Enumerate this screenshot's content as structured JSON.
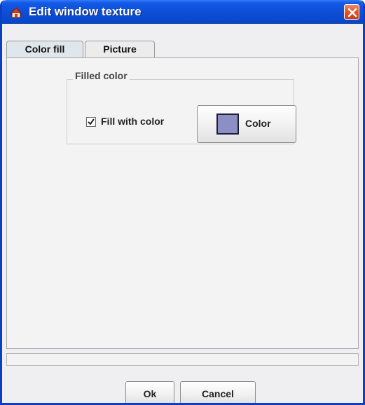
{
  "window": {
    "title": "Edit window texture",
    "icon": "app-icon",
    "close_icon": "close-icon"
  },
  "tabs": [
    {
      "label": "Color fill",
      "selected": true
    },
    {
      "label": "Picture",
      "selected": false
    }
  ],
  "filled_color_group": {
    "title": "Filled color",
    "fill_checkbox": {
      "label": "Fill with color",
      "checked": true
    },
    "color_button": {
      "label": "Color",
      "swatch_color": "#8b8fc4"
    }
  },
  "footer": {
    "ok_label": "Ok",
    "cancel_label": "Cancel"
  },
  "colors": {
    "titlebar": "#0d4fd6",
    "close": "#e2572f"
  }
}
